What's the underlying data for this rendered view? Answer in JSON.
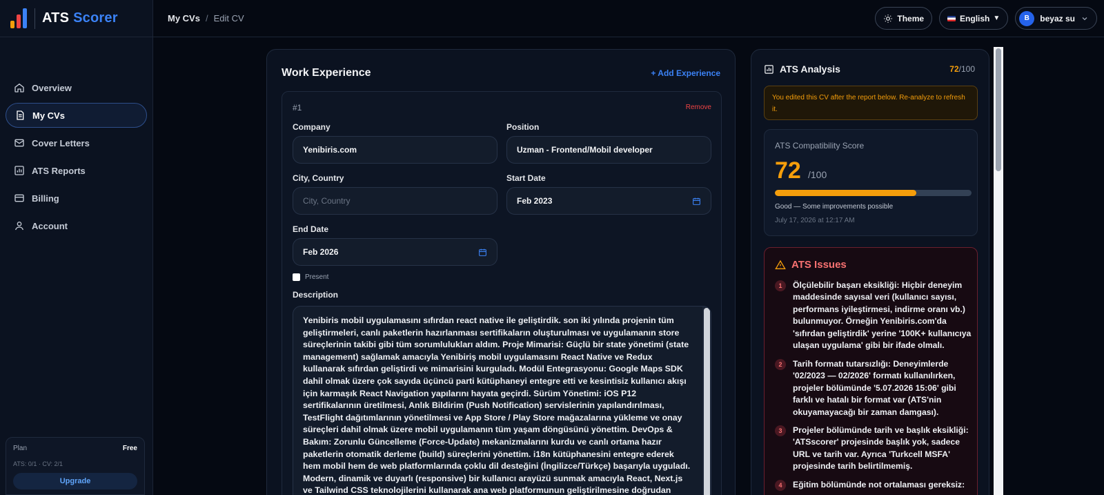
{
  "brand": {
    "ats": "ATS",
    "scorer": "Scorer",
    "colors": {
      "bar1": "#f59e0b",
      "bar2": "#ef4444",
      "bar3": "#3b82f6"
    }
  },
  "sidebar": {
    "items": [
      {
        "label": "Overview",
        "icon": "home-icon"
      },
      {
        "label": "My CVs",
        "icon": "document-icon",
        "active": true
      },
      {
        "label": "Cover Letters",
        "icon": "mail-icon"
      },
      {
        "label": "ATS Reports",
        "icon": "bar-chart-icon"
      },
      {
        "label": "Billing",
        "icon": "credit-card-icon"
      },
      {
        "label": "Account",
        "icon": "user-icon"
      }
    ],
    "plan": {
      "label": "Plan",
      "tier": "Free",
      "usage": "ATS: 0/1 · CV: 2/1",
      "upgrade": "Upgrade"
    }
  },
  "header": {
    "breadcrumb": [
      "My CVs",
      "Edit CV"
    ],
    "theme_label": "Theme",
    "language": "English",
    "user": {
      "initial": "B",
      "name": "beyaz su"
    }
  },
  "work": {
    "title": "Work Experience",
    "add_label": "+ Add Experience",
    "entry": {
      "number": "#1",
      "remove_label": "Remove",
      "company_label": "Company",
      "company_value": "Yenibiris.com",
      "position_label": "Position",
      "position_value": "Uzman - Frontend/Mobil developer",
      "city_label": "City, Country",
      "city_placeholder": "City, Country",
      "start_label": "Start Date",
      "start_value": "Feb 2023",
      "end_label": "End Date",
      "end_value": "Feb 2026",
      "present_label": "Present",
      "present_checked": false,
      "description_label": "Description",
      "description": "Yenibiris mobil uygulamasını sıfırdan react native ile geliştirdik. son iki yılında projenin tüm geliştirmeleri, canlı paketlerin hazırlanması sertifikaların oluşturulması ve uygulamanın store süreçlerinin takibi gibi tüm sorumlulukları aldım. Proje Mimarisi: Güçlü bir state yönetimi (state management) sağlamak amacıyla Yenibiriş mobil uygulamasını React Native ve Redux kullanarak sıfırdan geliştirdi ve mimarisini kurguladı. Modül Entegrasyonu: Google Maps SDK dahil olmak üzere çok sayıda üçüncü parti kütüphaneyi entegre etti ve kesintisiz kullanıcı akışı için karmaşık React Navigation yapılarını hayata geçirdi. Sürüm Yönetimi: iOS P12 sertifikalarının üretilmesi, Anlık Bildirim (Push Notification) servislerinin yapılandırılması, TestFlight dağıtımlarının yönetilmesi ve App Store / Play Store mağazalarına yükleme ve onay süreçleri dahil olmak üzere mobil uygulamanın tüm yaşam döngüsünü yönettim. DevOps & Bakım: Zorunlu Güncelleme (Force-Update) mekanizmalarını kurdu ve canlı ortama hazır paketlerin otomatik derleme (build) süreçlerini yönettim. i18n kütüphanesini entegre ederek hem mobil hem de web platformlarında çoklu dil desteğini (İngilizce/Türkçe) başarıyla uyguladı. Modern, dinamik ve duyarlı (responsive) bir kullanıcı arayüzü sunmak amacıyla React, Next.js ve Tailwind CSS teknolojilerini kullanarak ana web platformunun geliştirilmesine doğrudan katkıda bulundum. Karmaşık form süreçlerini"
    }
  },
  "ats": {
    "title": "ATS Analysis",
    "score": "72",
    "max": "/100",
    "warning": "You edited this CV after the report below. Re-analyze to refresh it.",
    "compat_title": "ATS Compatibility Score",
    "compat_score": "72",
    "compat_max": "/100",
    "score_fraction": 0.72,
    "status": "Good — Some improvements possible",
    "date": "July 17, 2026 at 12:17 AM",
    "issues_title": "ATS Issues",
    "issues": [
      {
        "num": "1",
        "text": "Ölçülebilir başarı eksikliği: Hiçbir deneyim maddesinde sayısal veri (kullanıcı sayısı, performans iyileştirmesi, indirme oranı vb.) bulunmuyor. Örneğin Yenibiris.com'da 'sıfırdan geliştirdik' yerine '100K+ kullanıcıya ulaşan uygulama' gibi bir ifade olmalı."
      },
      {
        "num": "2",
        "text": "Tarih formatı tutarsızlığı: Deneyimlerde '02/2023 — 02/2026' formatı kullanılırken, projeler bölümünde '5.07.2026 15:06' gibi farklı ve hatalı bir format var (ATS'nin okuyamayacağı bir zaman damgası)."
      },
      {
        "num": "3",
        "text": "Projeler bölümünde tarih ve başlık eksikliği: 'ATSscorer' projesinde başlık yok, sadece URL ve tarih var. Ayrıca 'Turkcell MSFA' projesinde tarih belirtilmemiş."
      },
      {
        "num": "4",
        "text": "Eğitim bölümünde not ortalaması gereksiz:"
      }
    ]
  }
}
